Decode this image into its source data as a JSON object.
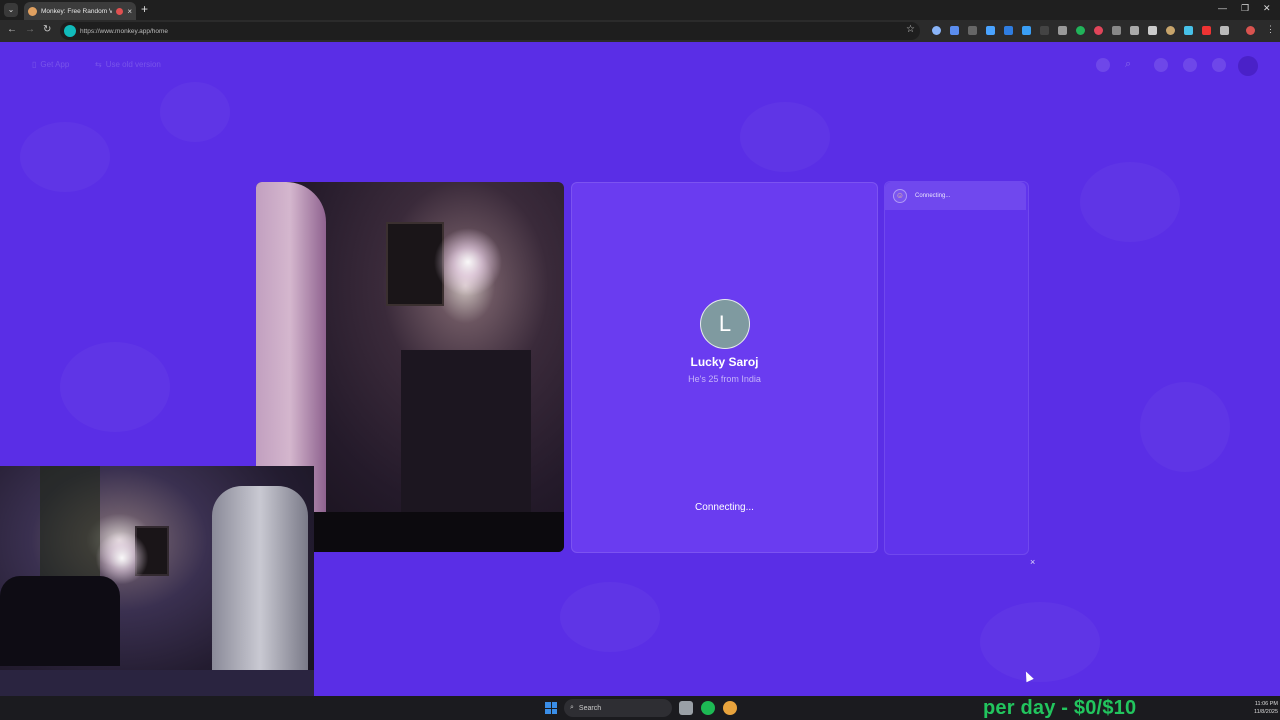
{
  "browser": {
    "tab_title": "Monkey: Free Random Video",
    "tab_close": "×",
    "new_tab": "+",
    "url": "https://www.monkey.app/home",
    "window_controls": [
      "—",
      "❐",
      "✕"
    ]
  },
  "header": {
    "get_app": "Get App",
    "old_version": "Use old version"
  },
  "call": {
    "peer_initial": "L",
    "peer_name": "Lucky Saroj",
    "peer_subtitle": "He's 25 from India",
    "status": "Connecting...",
    "chat_status": "Connecting...",
    "close": "×"
  },
  "taskbar": {
    "search_placeholder": "Search",
    "overlay": "per day - $0/$10",
    "time": "11:06 PM",
    "date": "11/8/2025"
  },
  "colors": {
    "page_bg": "#5a2ee6",
    "panel_bg": "#6a3cf0",
    "accent_green": "#22c55e"
  }
}
